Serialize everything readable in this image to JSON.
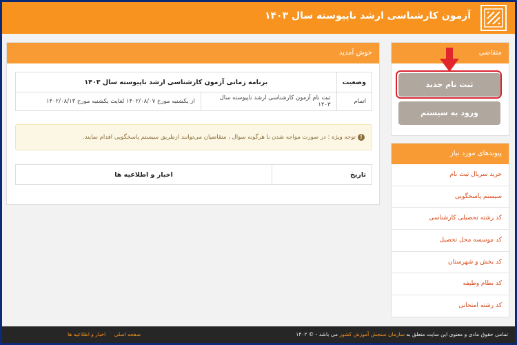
{
  "header": {
    "title": "آزمون کارشناسی ارشد ناپیوسته سال ۱۴۰۳",
    "logo_icon": "sanjesh-logo-icon"
  },
  "applicant_panel": {
    "title": "متقاضی",
    "register_button": "ثبت نام جدید",
    "login_button": "ورود به سیستم"
  },
  "links_panel": {
    "title": "پیوندهای مورد نیاز",
    "items": [
      "خرید سریال ثبت نام",
      "سیستم پاسخگویی",
      "کد رشته تحصیلی کارشناسی",
      "کد موسسه محل تحصیل",
      "کد بخش و شهرستان",
      "کد نظام وظیفه",
      "کد رشته امتحانی"
    ]
  },
  "welcome_panel": {
    "title": "خوش آمدید",
    "schedule": {
      "headers": [
        "وضعیت",
        "برنامه زمانی آزمون کارشناسی ارشد ناپیوسته سال ۱۴۰۳"
      ],
      "row": [
        "اتمام",
        "ثبت نام آزمون کارشناسی ارشد ناپیوسته سال ۱۴۰۳",
        "از یکشنبه مورخ ۱۴۰۲/۰۸/۰۷ لغایت یکشنبه مورخ ۱۴۰۲/۰۸/۱۳"
      ]
    },
    "note": "توجه ویژه : در صورت مواجه شدن با هرگونه سوال ، متقاضیان می‌توانند ازطریق سیستم پاسخگویی اقدام نمایند.",
    "news_headers": [
      "تاریخ",
      "اخبار و اطلاعیه ها"
    ]
  },
  "footer": {
    "copyright_prefix": "تمامی حقوق مادی و معنوی این سایت متعلق به",
    "organization": "سازمان سنجش آموزش کشور",
    "copyright_suffix": "می باشد - © ۱۴۰۲",
    "links": [
      "صفحه اصلی",
      "اخبار و اطلاعیه ها"
    ]
  },
  "colors": {
    "brand_orange": "#f7931e",
    "button_gray": "#b0a79f",
    "highlight_red": "#d82330",
    "frame_blue": "#0b2a78"
  }
}
